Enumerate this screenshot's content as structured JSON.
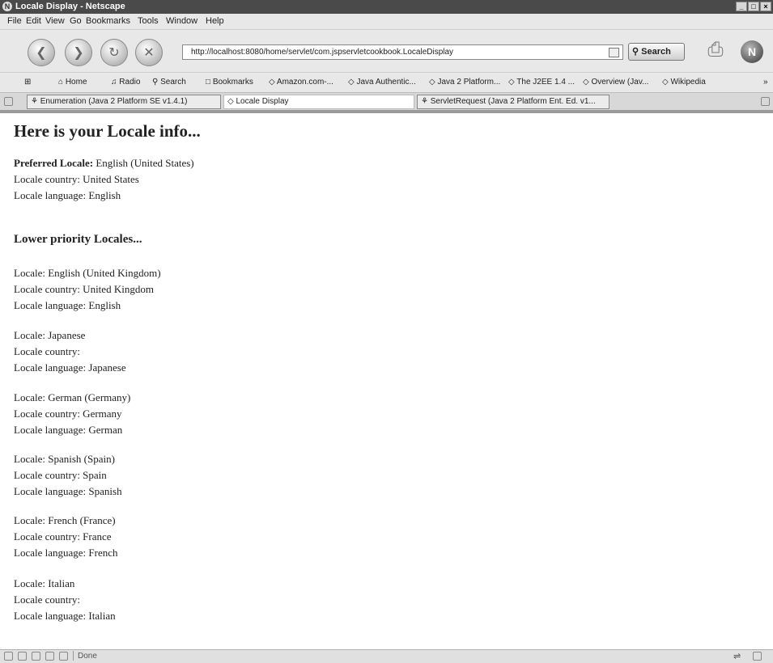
{
  "window": {
    "title": "Locale Display - Netscape",
    "buttons": [
      "_",
      "□",
      "×"
    ]
  },
  "menu": [
    "File",
    "Edit",
    "View",
    "Go",
    "Bookmarks",
    "Tools",
    "Window",
    "Help"
  ],
  "toolbar": {
    "url": "http://localhost:8080/home/servlet/com.jspservletcookbook.LocaleDisplay",
    "search_label": "Search"
  },
  "bookmarks": [
    "Home",
    "Radio",
    "Search",
    "Bookmarks",
    "Amazon.com-...",
    "Java Authentic...",
    "Java 2 Platform...",
    "The J2EE 1.4 ...",
    "Overview (Jav...",
    "Wikipedia"
  ],
  "tabs": [
    "Enumeration (Java 2 Platform SE v1.4.1)",
    "Locale Display",
    "ServletRequest (Java 2 Platform Ent. Ed. v1..."
  ],
  "page": {
    "heading": "Here is your Locale info...",
    "preferred_label": "Preferred Locale:",
    "preferred_value": " English (United States)",
    "preferred_country": "Locale country: United States",
    "preferred_language": "Locale language: English",
    "lower_heading": "Lower priority Locales...",
    "locales": [
      {
        "locale": "Locale: English (United Kingdom)",
        "country": "Locale country: United Kingdom",
        "language": "Locale language: English"
      },
      {
        "locale": "Locale: Japanese",
        "country": "Locale country:",
        "language": "Locale language: Japanese"
      },
      {
        "locale": "Locale: German (Germany)",
        "country": "Locale country: Germany",
        "language": "Locale language: German"
      },
      {
        "locale": "Locale: Spanish (Spain)",
        "country": "Locale country: Spain",
        "language": "Locale language: Spanish"
      },
      {
        "locale": "Locale: French (France)",
        "country": "Locale country: France",
        "language": "Locale language: French"
      },
      {
        "locale": "Locale: Italian",
        "country": "Locale country:",
        "language": "Locale language: Italian"
      }
    ]
  },
  "status": {
    "text": "Done"
  }
}
